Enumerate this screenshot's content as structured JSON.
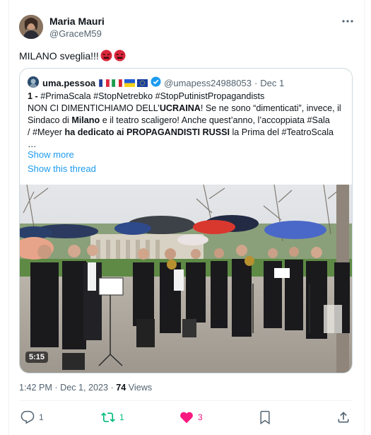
{
  "author": {
    "name": "Maria Mauri",
    "handle": "@GraceM59"
  },
  "tweet": {
    "text": "MILANO sveglia!!!"
  },
  "quote": {
    "name": "uma.pessoa",
    "handle": "@umapess24988053",
    "separator": "·",
    "date": "Dec 1",
    "lines": [
      {
        "parts": [
          {
            "t": "1 - ",
            "b": true
          },
          {
            "t": "#PrimaScala #StopNetrebko #StopPutinistPropagandists",
            "b": false
          }
        ]
      },
      {
        "parts": [
          {
            "t": "NON CI DIMENTICHIAMO DELL’",
            "b": false
          },
          {
            "t": "UCRAINA",
            "b": true
          },
          {
            "t": "! Se ne sono “dimenticati”, invece, il",
            "b": false
          }
        ]
      },
      {
        "parts": [
          {
            "t": "Sindaco di ",
            "b": false
          },
          {
            "t": "Milano",
            "b": true
          },
          {
            "t": " e il teatro scaligero! Anche quest’anno, l’accoppiata  #Sala",
            "b": false
          }
        ]
      },
      {
        "parts": [
          {
            "t": "/ #Meyer ",
            "b": false
          },
          {
            "t": "ha dedicato ai PROPAGANDISTI RUSSI",
            "b": true
          },
          {
            "t": " la Prima del #TeatroScala",
            "b": false
          }
        ]
      },
      {
        "parts": [
          {
            "t": "…",
            "b": false
          }
        ]
      }
    ],
    "show_more": "Show more",
    "show_thread": "Show this thread",
    "video_duration": "5:15"
  },
  "meta": {
    "time": "1:42 PM",
    "date": "Dec 1, 2023",
    "views_count": "74",
    "views_label": "Views"
  },
  "actions": {
    "replies": "1",
    "reposts": "1",
    "likes": "3"
  },
  "colors": {
    "accent": "#1d9bf0",
    "repost_green": "#00ba7c",
    "like_pink": "#f91880",
    "muted": "#536471"
  },
  "icons": [
    "more-icon",
    "verified-icon",
    "reply-icon",
    "repost-icon",
    "like-icon",
    "bookmark-icon",
    "share-icon"
  ]
}
